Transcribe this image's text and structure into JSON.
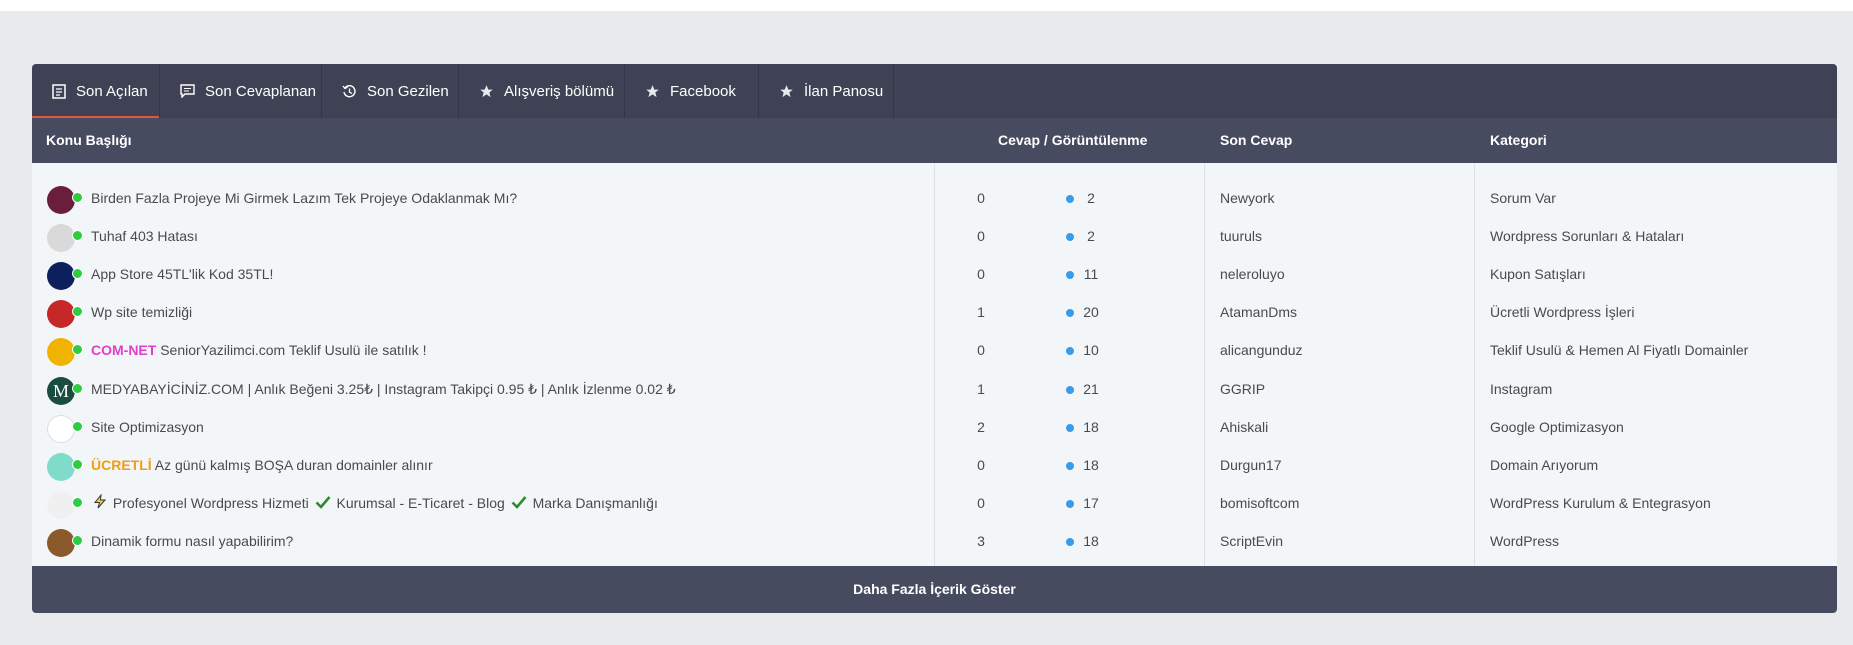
{
  "tabs": [
    {
      "label": "Son Açılan",
      "icon": "document-icon"
    },
    {
      "label": "Son Cevaplanan",
      "icon": "comment-icon"
    },
    {
      "label": "Son Gezilen",
      "icon": "history-icon"
    },
    {
      "label": "Alışveriş bölümü",
      "icon": "star-icon"
    },
    {
      "label": "Facebook",
      "icon": "star-icon"
    },
    {
      "label": "İlan Panosu",
      "icon": "star-icon"
    }
  ],
  "table": {
    "headers": {
      "topic": "Konu Başlığı",
      "stats": "Cevap / Görüntülenme",
      "last_reply": "Son Cevap",
      "category": "Kategori"
    },
    "rows": [
      {
        "title": "Birden Fazla Projeye Mi Girmek Lazım Tek Projeye Odaklanmak Mı?",
        "replies": "0",
        "views": "2",
        "user": "Newyork",
        "category": "Sorum Var",
        "avatar_color": "#6b1d3c"
      },
      {
        "title": "Tuhaf 403 Hatası",
        "replies": "0",
        "views": "2",
        "user": "tuuruls",
        "category": "Wordpress Sorunları & Hataları",
        "avatar_color": "#d9d9d9"
      },
      {
        "title": "App Store 45TL'lik Kod 35TL!",
        "replies": "0",
        "views": "11",
        "user": "neleroluyo",
        "category": "Kupon Satışları",
        "avatar_color": "#0d1f5c"
      },
      {
        "title": "Wp site temizliği",
        "replies": "1",
        "views": "20",
        "user": "AtamanDms",
        "category": "Ücretli Wordpress İşleri",
        "avatar_color": "#c62828"
      },
      {
        "prefix": "COM-NET",
        "prefix_color": "#e040c8",
        "title": "SeniorYazilimci.com Teklif Usulü ile satılık !",
        "replies": "0",
        "views": "10",
        "user": "alicangunduz",
        "category": "Teklif Usulü & Hemen Al Fiyatlı Domainler",
        "avatar_color": "#f0b400"
      },
      {
        "title": "MEDYABAYİCİNİZ.COM | Anlık Beğeni 3.25₺ | Instagram Takipçi 0.95 ₺ | Anlık İzlenme 0.02 ₺",
        "replies": "1",
        "views": "21",
        "user": "GGRIP",
        "category": "Instagram",
        "avatar_color": "#1b4d3e",
        "avatar_letter": "M"
      },
      {
        "title": "Site Optimizasyon",
        "replies": "2",
        "views": "18",
        "user": "Ahiskali",
        "category": "Google Optimizasyon",
        "avatar_color": "#ffffff"
      },
      {
        "prefix": "ÜCRETLİ",
        "prefix_color": "#f39c12",
        "title": "Az günü kalmış BOŞA duran domainler alınır",
        "replies": "0",
        "views": "18",
        "user": "Durgun17",
        "category": "Domain Arıyorum",
        "avatar_color": "#7fdbca"
      },
      {
        "title_parts": [
          "Profesyonel Wordpress Hizmeti",
          "Kurumsal - E-Ticaret - Blog",
          "Marka Danışmanlığı"
        ],
        "replies": "0",
        "views": "17",
        "user": "bomisoftcom",
        "category": "WordPress Kurulum & Entegrasyon",
        "avatar_color": "#f0f0f0"
      },
      {
        "title": "Dinamik formu nasıl yapabilirim?",
        "replies": "3",
        "views": "18",
        "user": "ScriptEvin",
        "category": "WordPress",
        "avatar_color": "#8b5a2b"
      }
    ]
  },
  "footer": {
    "label": "Daha Fazla İçerik Göster"
  },
  "colors": {
    "tab_active_underline": "#e2553f",
    "online": "#2ecc40",
    "dot": "#3a9be8"
  }
}
